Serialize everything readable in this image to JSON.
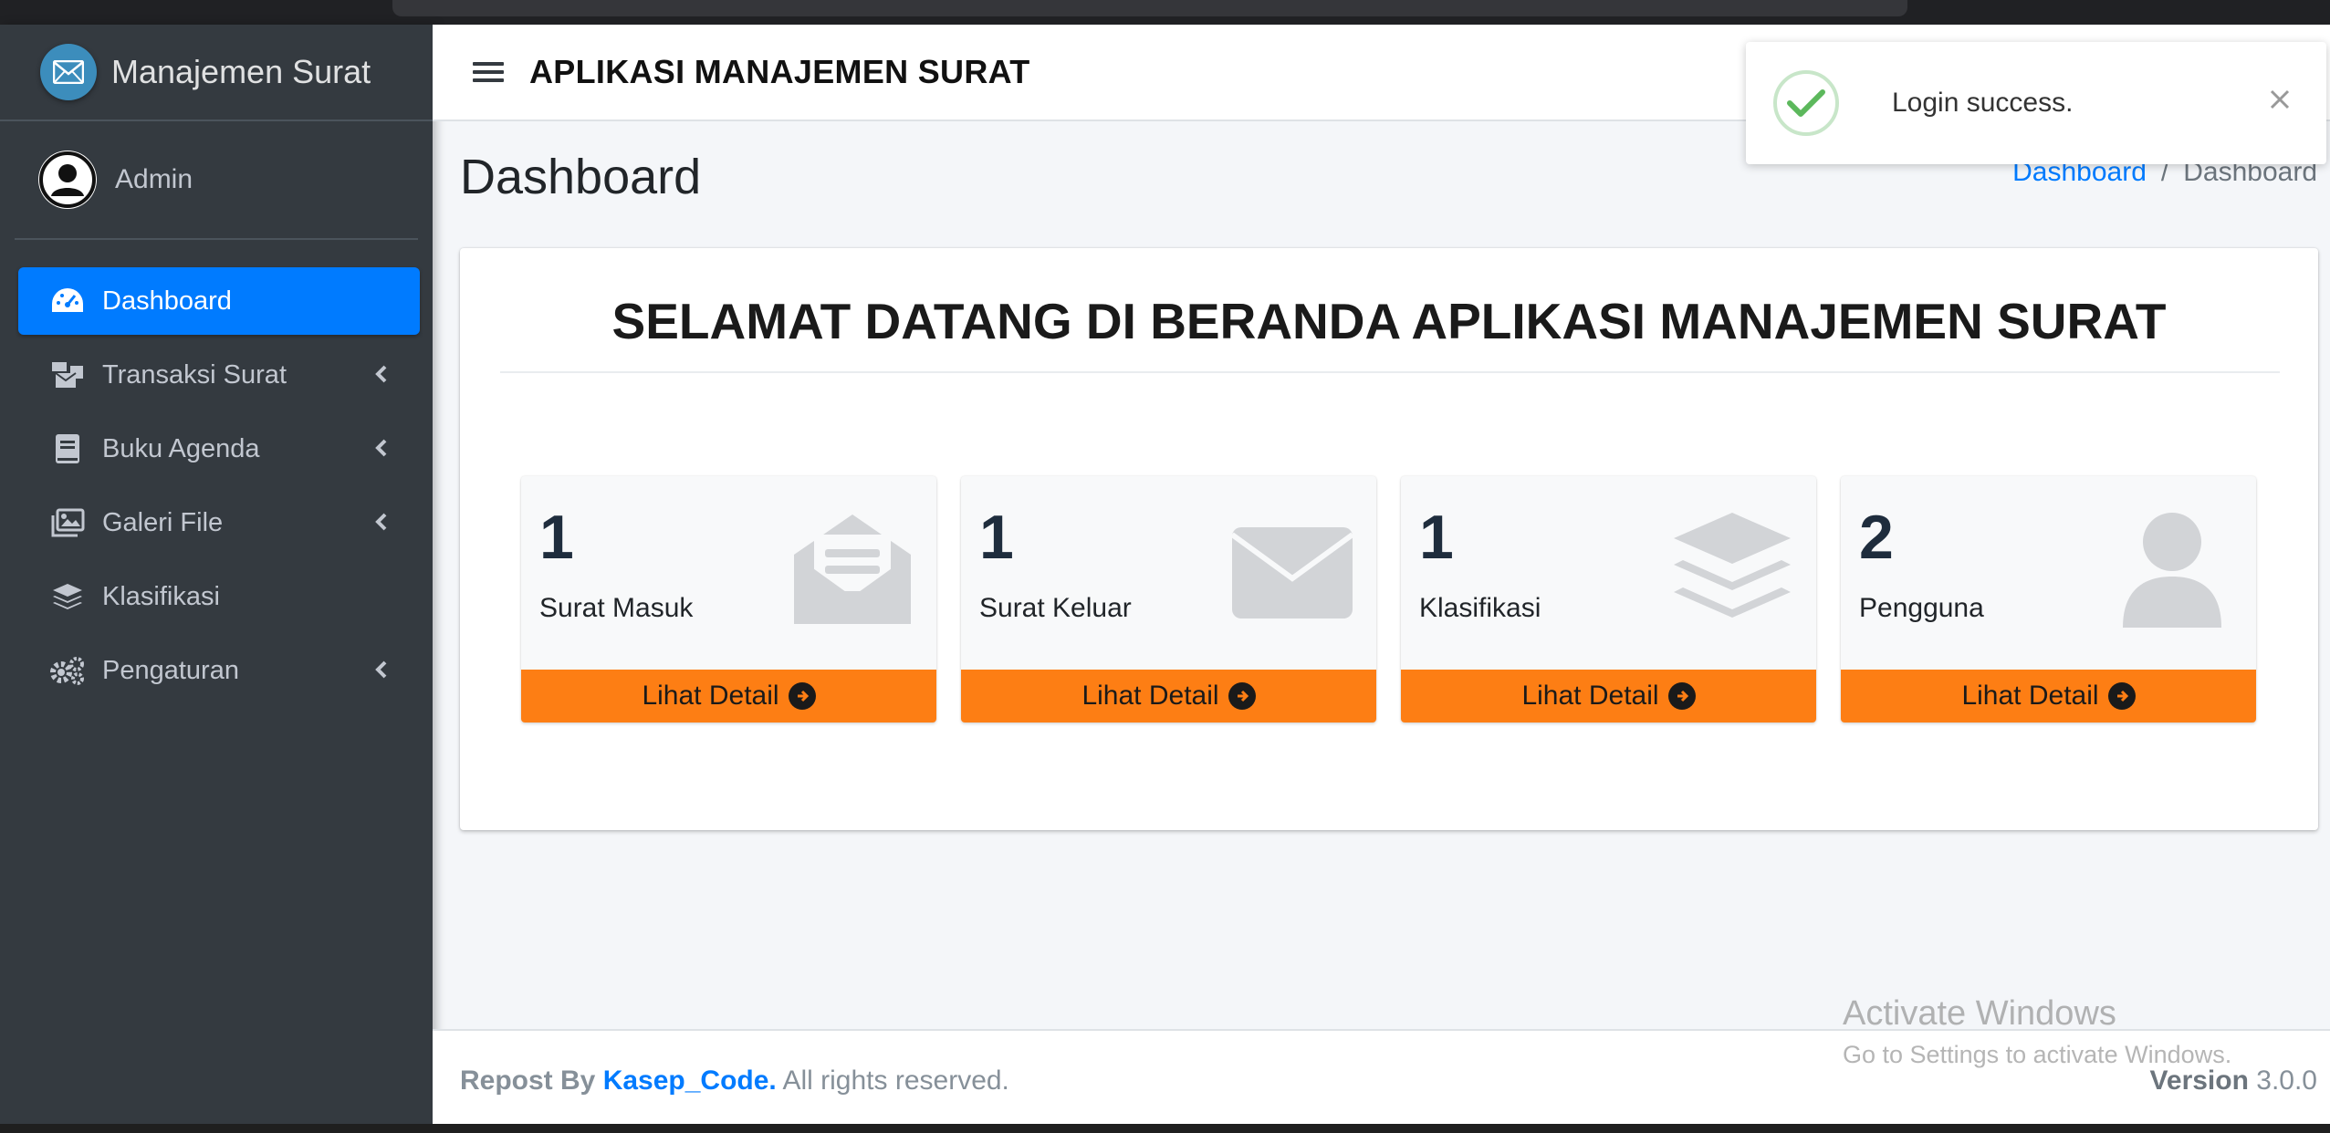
{
  "sidebar": {
    "brand": "Manajemen Surat",
    "user": "Admin",
    "items": [
      {
        "label": "Dashboard",
        "icon": "tachometer-icon",
        "active": true,
        "chevron": false
      },
      {
        "label": "Transaksi Surat",
        "icon": "mail-bulk-icon",
        "active": false,
        "chevron": true
      },
      {
        "label": "Buku Agenda",
        "icon": "book-icon",
        "active": false,
        "chevron": true
      },
      {
        "label": "Galeri File",
        "icon": "images-icon",
        "active": false,
        "chevron": true
      },
      {
        "label": "Klasifikasi",
        "icon": "layer-group-icon",
        "active": false,
        "chevron": false
      },
      {
        "label": "Pengaturan",
        "icon": "cogs-icon",
        "active": false,
        "chevron": true
      }
    ]
  },
  "header": {
    "title": "APLIKASI MANAJEMEN SURAT"
  },
  "content": {
    "page_title": "Dashboard",
    "breadcrumb": {
      "link": "Dashboard",
      "separator": "/",
      "current": "Dashboard"
    },
    "welcome": "SELAMAT DATANG DI BERANDA APLIKASI MANAJEMEN SURAT",
    "boxes": [
      {
        "count": "1",
        "label": "Surat Masuk",
        "icon": "envelope-open-text-icon",
        "footer": "Lihat Detail"
      },
      {
        "count": "1",
        "label": "Surat Keluar",
        "icon": "envelope-icon",
        "footer": "Lihat Detail"
      },
      {
        "count": "1",
        "label": "Klasifikasi",
        "icon": "layer-group-icon",
        "footer": "Lihat Detail"
      },
      {
        "count": "2",
        "label": "Pengguna",
        "icon": "user-icon",
        "footer": "Lihat Detail"
      }
    ]
  },
  "toast": {
    "message": "Login success."
  },
  "footer": {
    "prefix": "Repost By",
    "brand": "Kasep_Code.",
    "suffix": "All rights reserved.",
    "version_label": "Version",
    "version": "3.0.0"
  },
  "watermark": {
    "line1": "Activate Windows",
    "line2": "Go to Settings to activate Windows."
  },
  "colors": {
    "sidebar_bg": "#343a40",
    "active": "#007bff",
    "box_footer": "#fd7e14",
    "link": "#007bff",
    "toast_success": "#5cb85c"
  }
}
